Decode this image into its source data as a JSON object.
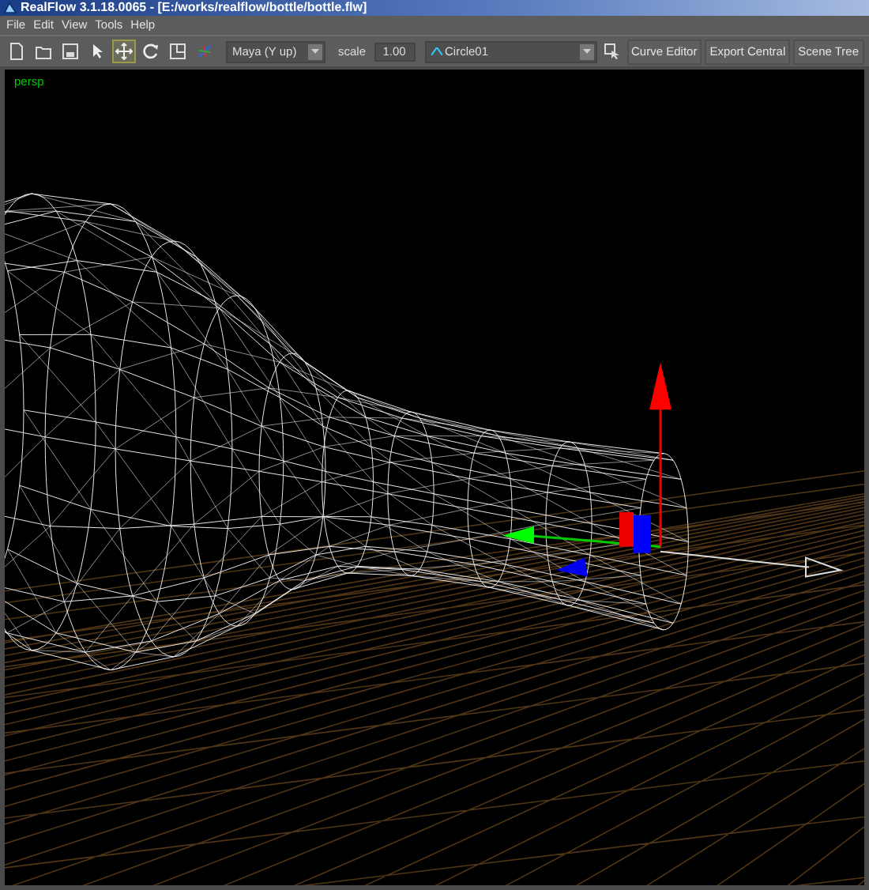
{
  "window": {
    "title": "RealFlow 3.1.18.0065 - [E:/works/realflow/bottle/bottle.flw]"
  },
  "menu": [
    "File",
    "Edit",
    "View",
    "Tools",
    "Help"
  ],
  "tools": [
    {
      "kind": "new",
      "selected": false
    },
    {
      "kind": "open",
      "selected": false
    },
    {
      "kind": "save",
      "selected": false
    },
    {
      "kind": "select",
      "selected": false
    },
    {
      "kind": "move",
      "selected": true
    },
    {
      "kind": "rotate",
      "selected": false
    },
    {
      "kind": "scale",
      "selected": false
    },
    {
      "kind": "axes",
      "selected": false
    }
  ],
  "axis_dropdown": {
    "value": "Maya (Y up)"
  },
  "scale": {
    "label": "scale",
    "value": "1.00"
  },
  "object_dropdown": {
    "value": "Circle01"
  },
  "buttons": [
    "Curve Editor",
    "Export Central",
    "Scene Tree"
  ],
  "viewport": {
    "label": "persp"
  }
}
